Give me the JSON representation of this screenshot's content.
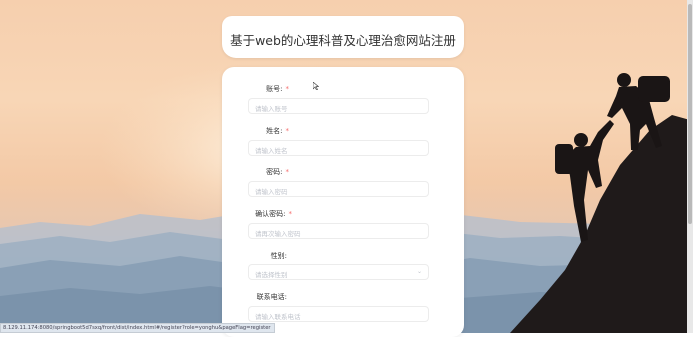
{
  "page": {
    "title": "基于web的心理科普及心理治愈网站注册"
  },
  "form": {
    "fields": [
      {
        "label": "账号:",
        "required": true,
        "placeholder": "请输入账号",
        "type": "input"
      },
      {
        "label": "姓名:",
        "required": true,
        "placeholder": "请输入姓名",
        "type": "input"
      },
      {
        "label": "密码:",
        "required": true,
        "placeholder": "请输入密码",
        "type": "input"
      },
      {
        "label": "确认密码:",
        "required": true,
        "placeholder": "请再次输入密码",
        "type": "input"
      },
      {
        "label": "性别:",
        "required": false,
        "placeholder": "请选择性别",
        "type": "select"
      },
      {
        "label": "联系电话:",
        "required": false,
        "placeholder": "请输入联系电话",
        "type": "input"
      }
    ],
    "required_mark": "*"
  },
  "statusbar": {
    "url": "8.129.11.174:8080/springboot5d7sxq/front/dist/index.html#/register?role=yonghu&pageFlag=register"
  },
  "colors": {
    "required": "#f56c6c",
    "placeholder": "#c0c4cc"
  }
}
